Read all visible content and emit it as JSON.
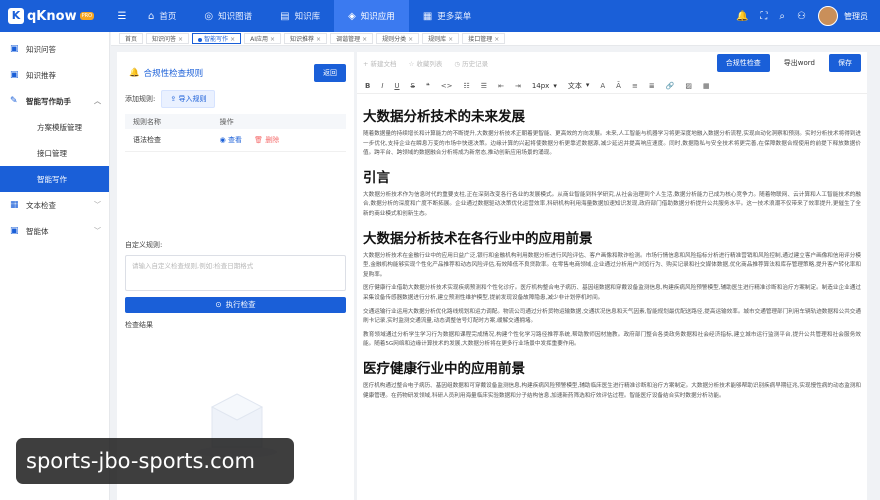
{
  "header": {
    "logo": "qKnow",
    "badge": "PRO",
    "nav": [
      {
        "label": "首页",
        "icon": "home-icon"
      },
      {
        "label": "知识图谱",
        "icon": "graph-icon"
      },
      {
        "label": "知识库",
        "icon": "library-icon"
      },
      {
        "label": "知识应用",
        "icon": "app-icon"
      },
      {
        "label": "更多菜单",
        "icon": "more-icon"
      }
    ],
    "active_nav": 3,
    "user": "管理员"
  },
  "sidebar": {
    "items": [
      {
        "label": "知识问答"
      },
      {
        "label": "知识推荐"
      },
      {
        "label": "智能写作助手"
      },
      {
        "label": "方案模版管理"
      },
      {
        "label": "接口管理"
      },
      {
        "label": "智能写作"
      },
      {
        "label": "文本检查"
      },
      {
        "label": "智能体"
      }
    ]
  },
  "tabs": [
    "首页",
    "知识问答",
    "智能写作",
    "AI应用",
    "知识推荐",
    "调谐管理",
    "规则分类",
    "规则库",
    "接口管理"
  ],
  "left_panel": {
    "title": "合规性检查规则",
    "back": "返回",
    "add_rule_label": "添加规则:",
    "import": "导入规则",
    "col_name": "规则名称",
    "col_op": "操作",
    "rows": [
      {
        "name": "语法检查",
        "view": "查看",
        "delete": "删除"
      }
    ],
    "custom_label": "自定义规则:",
    "custom_placeholder": "请输入自定义检查规则,例如:检查日期格式",
    "run": "执行检查",
    "result_label": "检查结果"
  },
  "editor": {
    "top_actions": [
      "新建文档",
      "收藏列表",
      "历史记录"
    ],
    "check": "合规性检查",
    "export": "导出word",
    "save": "保存",
    "font_size": "14px",
    "text_style": "文本",
    "sections": [
      {
        "title": "大数据分析技术的未来发展",
        "paras": [
          "随着数据量的持续增长和计算能力的不断提升,大数据分析技术正朝着更智能、更高效的方向发展。未来,人工智能与机器学习将更深度地融入数据分析流程,实现自动化洞察和预测。实时分析技术将得到进一步优化,支持企业在瞬息万变的市场中快速决策。边缘计算的兴起将使数据分析更靠近数据源,减少延迟并提高响应速度。同时,数据隐私与安全技术将更完善,在保障数据合规使用的前提下释放数据价值。跨平台、跨领域的数据融合分析将成为新常态,推动创新应用场景的涌现。"
        ]
      },
      {
        "title": "引言",
        "paras": [
          "大数据分析技术作为信息时代的重要支柱,正在深刻改变各行各业的发展模式。从商业智能到科学研究,从社会治理到个人生活,数据分析能力已成为核心竞争力。随着物联网、云计算和人工智能技术的融合,数据分析的深度和广度不断拓展。企业通过数据驱动决策优化运营效率,科研机构利用海量数据加速知识发现,政府部门借助数据分析提升公共服务水平。这一技术浪潮不仅带来了效率提升,更催生了全新的商业模式和创新生态。"
        ]
      },
      {
        "title": "大数据分析技术在各行业中的应用前景",
        "paras": [
          "大数据分析技术在金融行业中的应用日益广泛,银行和金融机构利用数据分析进行风险评估、客户画像和欺诈检测。市场行情信息和风险指标分析进行精准营销和风险控制,通过建立客户画像和信用评分模型,金融机构能够实现个性化产品推荐和动态风险评估,有效降低不良贷款率。在零售电商领域,企业通过分析用户浏览行为、购买记录和社交媒体数据,优化商品推荐算法和库存管理策略,提升客户转化率和复购率。",
          "医疗健康行业借助大数据分析技术实现疾病预测和个性化诊疗。医疗机构整合电子病历、基因组数据和穿戴设备监测信息,构建疾病风险预警模型,辅助医生进行精准诊断和治疗方案制定。制造业企业通过采集设备传感器数据进行分析,建立预测性维护模型,提前发现设备故障隐患,减少非计划停机时间。",
          "交通运输行业运用大数据分析优化路线规划和运力调配。物流公司通过分析货物运输数据,交通状况信息和天气因素,智能规划最优配送路径,提高运输效率。城市交通管理部门利用车辆轨迹数据和公共交通刷卡记录,实时监测交通流量,动态调整信号灯配时方案,缓解交通拥堵。",
          "教育领域通过分析学生学习行为数据和课程完成情况,构建个性化学习路径推荐系统,帮助教师因材施教。政府部门整合各类政务数据和社会经济指标,建立城市运行监测平台,提升公共管理和社会服务效能。随着5G网络和边缘计算技术的发展,大数据分析将在更多行业场景中发挥重要作用。"
        ]
      },
      {
        "title": "医疗健康行业中的应用前景",
        "paras": [
          "医疗机构通过整合电子病历、基因组数据和可穿戴设备监测信息,构建疾病风险预警模型,辅助临床医生进行精准诊断和治疗方案制定。大数据分析技术能够帮助识别疾病早期征兆,实现慢性病的动态监测和健康管理。在药物研发领域,科研人员利用海量临床实验数据和分子结构信息,加速新药筛选和疗效评估过程。智能医疗设备结合实时数据分析功能。"
        ]
      }
    ]
  },
  "watermark": "sports-jbo-sports.com"
}
